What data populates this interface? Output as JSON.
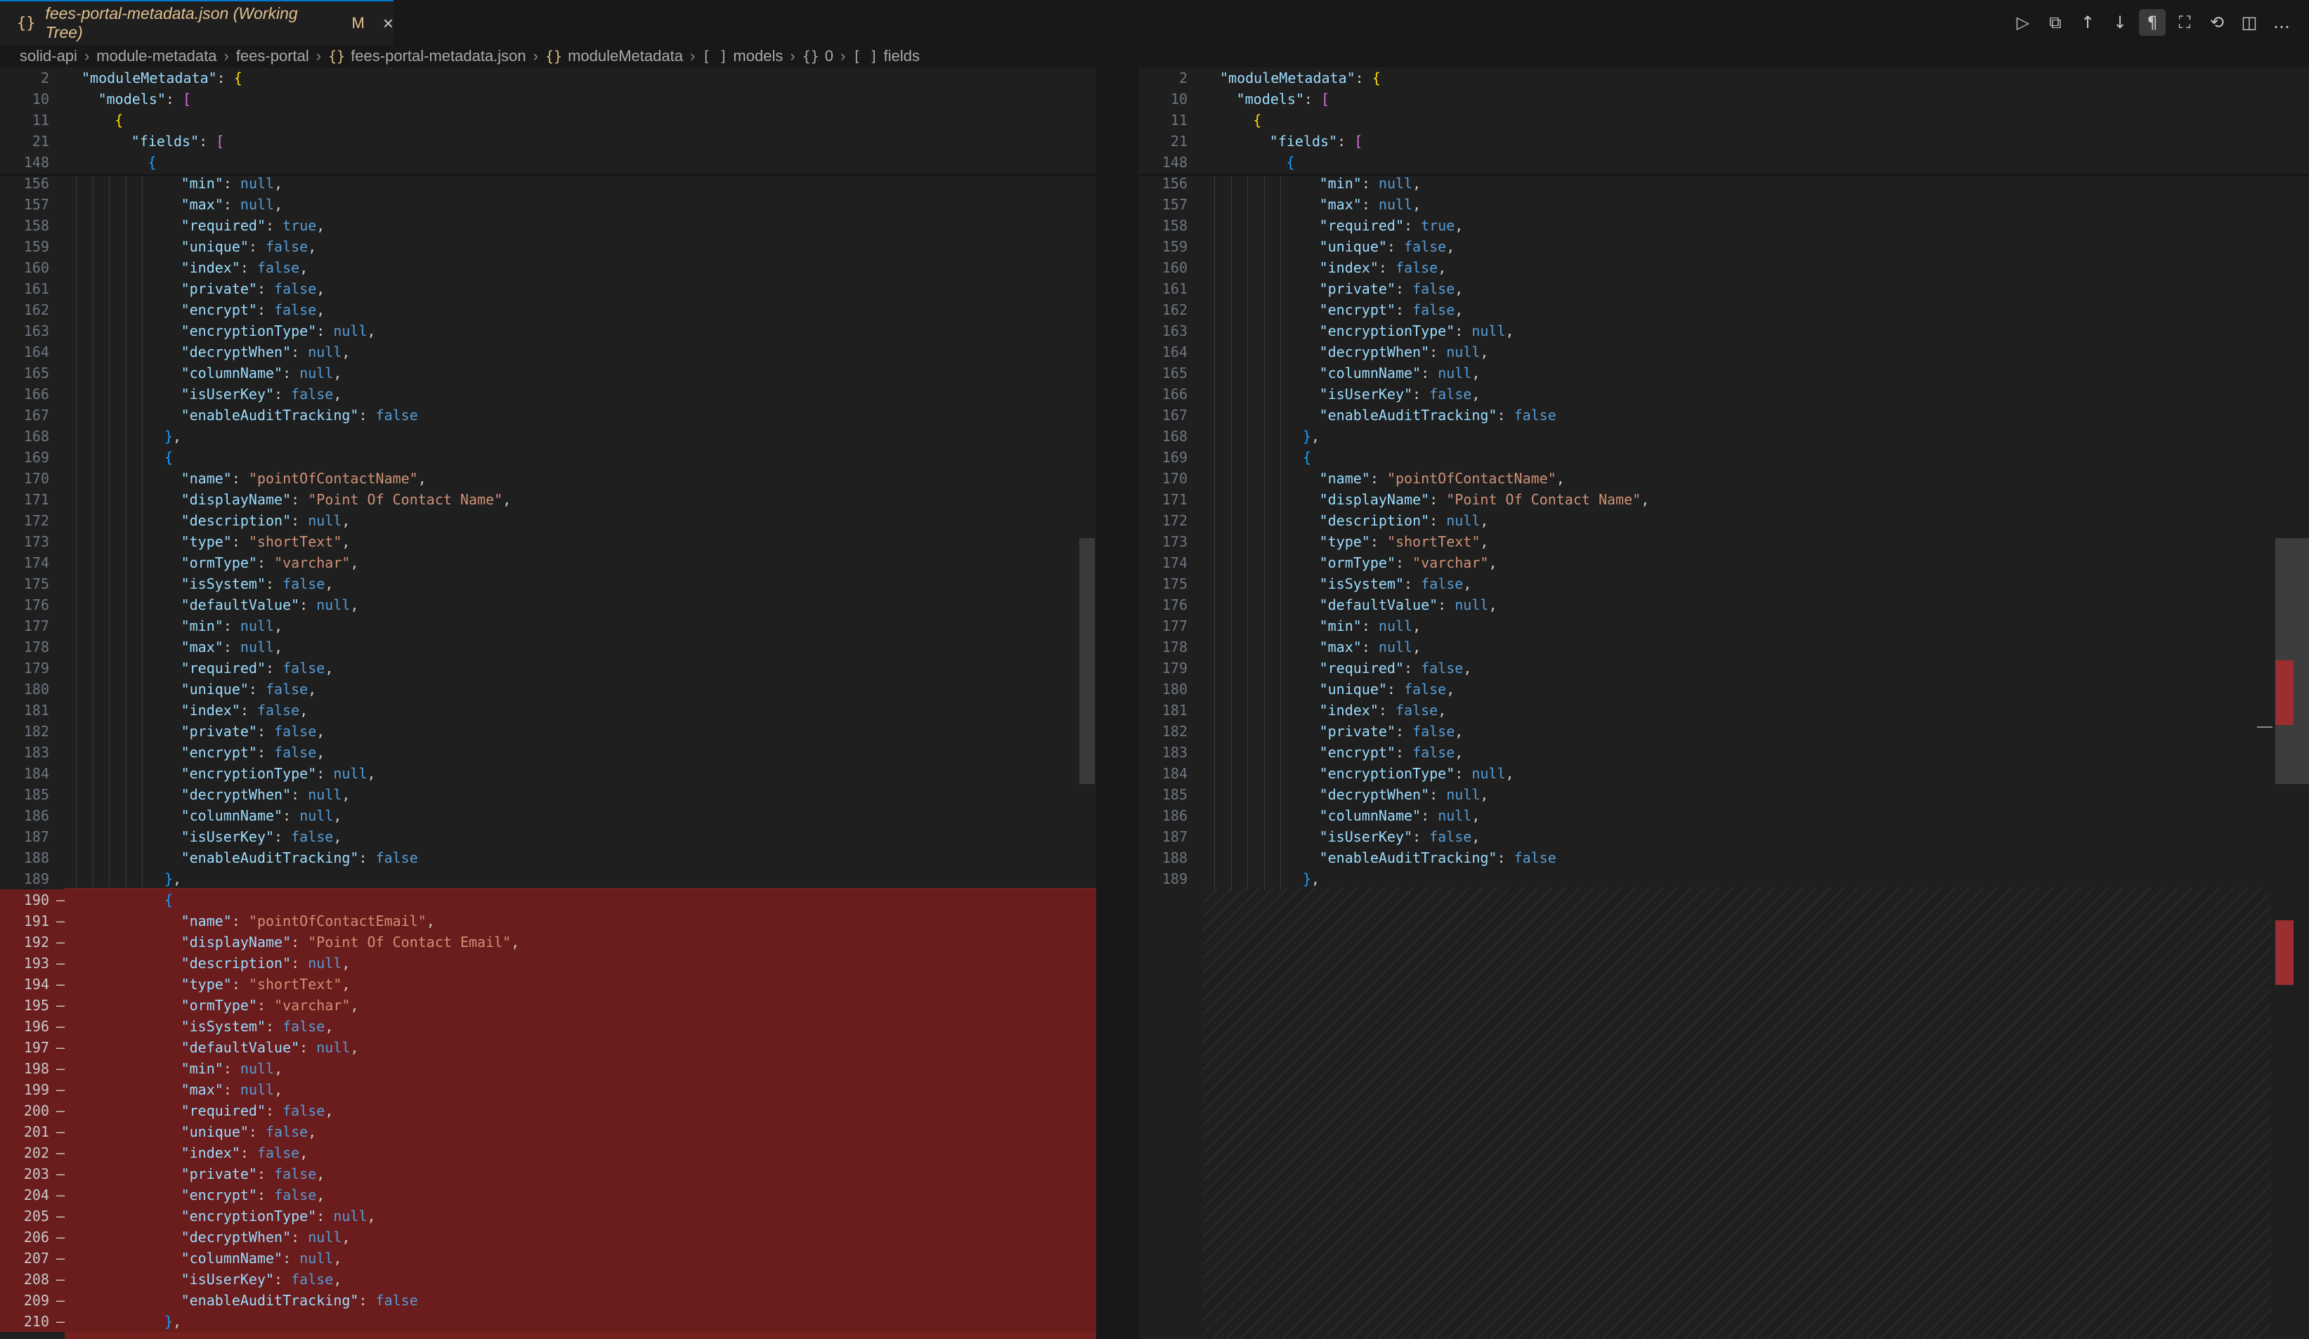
{
  "tab": {
    "icon": "{}",
    "title": "fees-portal-metadata.json (Working Tree)",
    "badge": "M",
    "close": "×"
  },
  "toolbar": {
    "icons": [
      "run-icon",
      "open-file-icon",
      "arrow-up-icon",
      "arrow-down-icon",
      "pilcrow-icon",
      "map-icon",
      "revert-icon",
      "split-editor-icon",
      "more-icon"
    ],
    "glyphs": [
      "▷",
      "⧉",
      "↑",
      "↓",
      "¶",
      "⛶",
      "⟲",
      "◫",
      "…"
    ]
  },
  "breadcrumb": {
    "items": [
      {
        "icon": "",
        "label": "solid-api"
      },
      {
        "icon": "",
        "label": "module-metadata"
      },
      {
        "icon": "",
        "label": "fees-portal"
      },
      {
        "icon": "{}",
        "label": "fees-portal-metadata.json"
      },
      {
        "icon": "{}",
        "label": "moduleMetadata"
      },
      {
        "icon": "[ ]",
        "label": "models"
      },
      {
        "icon": "{}",
        "label": "0"
      },
      {
        "icon": "[ ]",
        "label": "fields"
      }
    ]
  },
  "sticky": [
    {
      "n": "2",
      "indent": 1,
      "text": "\"moduleMetadata\": {"
    },
    {
      "n": "10",
      "indent": 2,
      "text": "\"models\": ["
    },
    {
      "n": "11",
      "indent": 3,
      "text": "{"
    },
    {
      "n": "21",
      "indent": 4,
      "text": "\"fields\": ["
    },
    {
      "n": "148",
      "indent": 5,
      "text": "{"
    }
  ],
  "left_lines": [
    {
      "n": "156",
      "indent": 6,
      "text": "\"min\": null,"
    },
    {
      "n": "157",
      "indent": 6,
      "text": "\"max\": null,"
    },
    {
      "n": "158",
      "indent": 6,
      "text": "\"required\": true,"
    },
    {
      "n": "159",
      "indent": 6,
      "text": "\"unique\": false,"
    },
    {
      "n": "160",
      "indent": 6,
      "text": "\"index\": false,"
    },
    {
      "n": "161",
      "indent": 6,
      "text": "\"private\": false,"
    },
    {
      "n": "162",
      "indent": 6,
      "text": "\"encrypt\": false,"
    },
    {
      "n": "163",
      "indent": 6,
      "text": "\"encryptionType\": null,"
    },
    {
      "n": "164",
      "indent": 6,
      "text": "\"decryptWhen\": null,"
    },
    {
      "n": "165",
      "indent": 6,
      "text": "\"columnName\": null,"
    },
    {
      "n": "166",
      "indent": 6,
      "text": "\"isUserKey\": false,"
    },
    {
      "n": "167",
      "indent": 6,
      "text": "\"enableAuditTracking\": false"
    },
    {
      "n": "168",
      "indent": 5,
      "text": "},"
    },
    {
      "n": "169",
      "indent": 5,
      "text": "{"
    },
    {
      "n": "170",
      "indent": 6,
      "text": "\"name\": \"pointOfContactName\","
    },
    {
      "n": "171",
      "indent": 6,
      "text": "\"displayName\": \"Point Of Contact Name\","
    },
    {
      "n": "172",
      "indent": 6,
      "text": "\"description\": null,"
    },
    {
      "n": "173",
      "indent": 6,
      "text": "\"type\": \"shortText\","
    },
    {
      "n": "174",
      "indent": 6,
      "text": "\"ormType\": \"varchar\","
    },
    {
      "n": "175",
      "indent": 6,
      "text": "\"isSystem\": false,"
    },
    {
      "n": "176",
      "indent": 6,
      "text": "\"defaultValue\": null,"
    },
    {
      "n": "177",
      "indent": 6,
      "text": "\"min\": null,"
    },
    {
      "n": "178",
      "indent": 6,
      "text": "\"max\": null,"
    },
    {
      "n": "179",
      "indent": 6,
      "text": "\"required\": false,"
    },
    {
      "n": "180",
      "indent": 6,
      "text": "\"unique\": false,"
    },
    {
      "n": "181",
      "indent": 6,
      "text": "\"index\": false,"
    },
    {
      "n": "182",
      "indent": 6,
      "text": "\"private\": false,"
    },
    {
      "n": "183",
      "indent": 6,
      "text": "\"encrypt\": false,"
    },
    {
      "n": "184",
      "indent": 6,
      "text": "\"encryptionType\": null,"
    },
    {
      "n": "185",
      "indent": 6,
      "text": "\"decryptWhen\": null,"
    },
    {
      "n": "186",
      "indent": 6,
      "text": "\"columnName\": null,"
    },
    {
      "n": "187",
      "indent": 6,
      "text": "\"isUserKey\": false,"
    },
    {
      "n": "188",
      "indent": 6,
      "text": "\"enableAuditTracking\": false"
    },
    {
      "n": "189",
      "indent": 5,
      "text": "},"
    },
    {
      "n": "190",
      "indent": 5,
      "text": "{",
      "removed": true
    },
    {
      "n": "191",
      "indent": 6,
      "text": "\"name\": \"pointOfContactEmail\",",
      "removed": true
    },
    {
      "n": "192",
      "indent": 6,
      "text": "\"displayName\": \"Point Of Contact Email\",",
      "removed": true
    },
    {
      "n": "193",
      "indent": 6,
      "text": "\"description\": null,",
      "removed": true
    },
    {
      "n": "194",
      "indent": 6,
      "text": "\"type\": \"shortText\",",
      "removed": true
    },
    {
      "n": "195",
      "indent": 6,
      "text": "\"ormType\": \"varchar\",",
      "removed": true
    },
    {
      "n": "196",
      "indent": 6,
      "text": "\"isSystem\": false,",
      "removed": true
    },
    {
      "n": "197",
      "indent": 6,
      "text": "\"defaultValue\": null,",
      "removed": true
    },
    {
      "n": "198",
      "indent": 6,
      "text": "\"min\": null,",
      "removed": true
    },
    {
      "n": "199",
      "indent": 6,
      "text": "\"max\": null,",
      "removed": true
    },
    {
      "n": "200",
      "indent": 6,
      "text": "\"required\": false,",
      "removed": true
    },
    {
      "n": "201",
      "indent": 6,
      "text": "\"unique\": false,",
      "removed": true
    },
    {
      "n": "202",
      "indent": 6,
      "text": "\"index\": false,",
      "removed": true
    },
    {
      "n": "203",
      "indent": 6,
      "text": "\"private\": false,",
      "removed": true
    },
    {
      "n": "204",
      "indent": 6,
      "text": "\"encrypt\": false,",
      "removed": true
    },
    {
      "n": "205",
      "indent": 6,
      "text": "\"encryptionType\": null,",
      "removed": true
    },
    {
      "n": "206",
      "indent": 6,
      "text": "\"decryptWhen\": null,",
      "removed": true
    },
    {
      "n": "207",
      "indent": 6,
      "text": "\"columnName\": null,",
      "removed": true
    },
    {
      "n": "208",
      "indent": 6,
      "text": "\"isUserKey\": false,",
      "removed": true
    },
    {
      "n": "209",
      "indent": 6,
      "text": "\"enableAuditTracking\": false",
      "removed": true
    },
    {
      "n": "210",
      "indent": 5,
      "text": "},",
      "removed": true
    }
  ],
  "right_lines_count": 34,
  "colors": {
    "key": "#9cdcfe",
    "string": "#ce9178",
    "keyword": "#569cd6",
    "removed_bg": "#74201f",
    "accent": "#0078d4"
  }
}
